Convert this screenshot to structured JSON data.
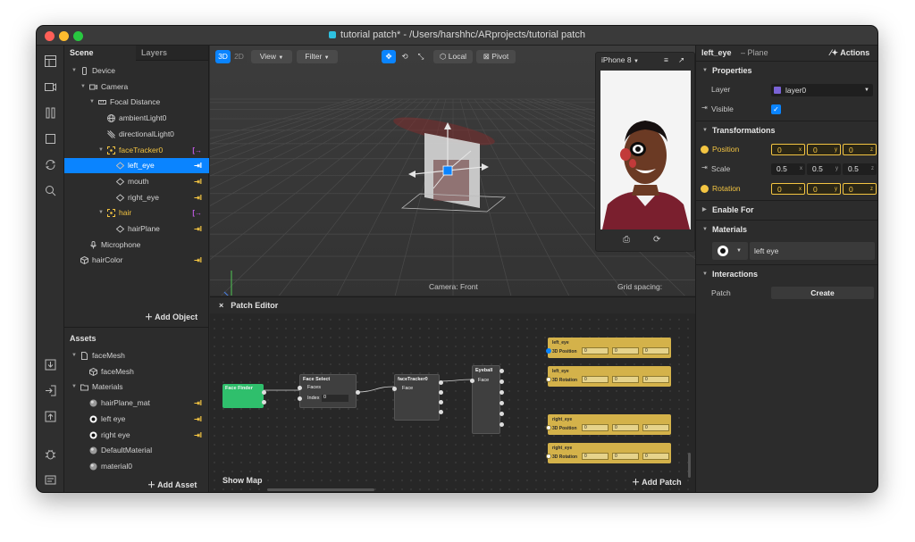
{
  "window": {
    "title": "tutorial patch* - /Users/harshhc/ARprojects/tutorial patch"
  },
  "scene": {
    "tabs": [
      "Scene",
      "Layers"
    ],
    "items": [
      {
        "label": "Device",
        "depth": 0,
        "caret": "▼",
        "icon": "phone-icon",
        "action": ""
      },
      {
        "label": "Camera",
        "depth": 1,
        "caret": "▼",
        "icon": "camera-icon",
        "action": ""
      },
      {
        "label": "Focal Distance",
        "depth": 2,
        "caret": "▼",
        "icon": "ruler-icon",
        "action": ""
      },
      {
        "label": "ambientLight0",
        "depth": 3,
        "caret": "",
        "icon": "globe-icon",
        "action": ""
      },
      {
        "label": "directionalLight0",
        "depth": 3,
        "caret": "",
        "icon": "light-icon",
        "action": ""
      },
      {
        "label": "faceTracker0",
        "depth": 3,
        "caret": "▼",
        "icon": "face-tracker-icon",
        "action": "[→",
        "yellow": true
      },
      {
        "label": "left_eye",
        "depth": 4,
        "caret": "",
        "icon": "plane-icon",
        "action": "⇥I",
        "selected": true
      },
      {
        "label": "mouth",
        "depth": 4,
        "caret": "",
        "icon": "plane-icon",
        "action": "⇥I"
      },
      {
        "label": "right_eye",
        "depth": 4,
        "caret": "",
        "icon": "plane-icon",
        "action": "⇥I"
      },
      {
        "label": "hair",
        "depth": 3,
        "caret": "▼",
        "icon": "face-tracker-icon",
        "action": "[→",
        "yellow": true
      },
      {
        "label": "hairPlane",
        "depth": 4,
        "caret": "",
        "icon": "plane-icon",
        "action": "⇥I"
      },
      {
        "label": "Microphone",
        "depth": 1,
        "caret": "",
        "icon": "microphone-icon",
        "action": ""
      },
      {
        "label": "hairColor",
        "depth": 0,
        "caret": "",
        "icon": "cube-icon",
        "action": "⇥I"
      }
    ],
    "add_object": "Add Object"
  },
  "assets": {
    "title": "Assets",
    "items": [
      {
        "label": "faceMesh",
        "depth": 0,
        "caret": "▼",
        "icon": "file-icon",
        "action": ""
      },
      {
        "label": "faceMesh",
        "depth": 1,
        "caret": "",
        "icon": "cube-icon",
        "action": ""
      },
      {
        "label": "Materials",
        "depth": 0,
        "caret": "▼",
        "icon": "folder-icon",
        "action": ""
      },
      {
        "label": "hairPlane_mat",
        "depth": 1,
        "caret": "",
        "icon": "sphere-icon",
        "action": "⇥I"
      },
      {
        "label": "left eye",
        "depth": 1,
        "caret": "",
        "icon": "eye-material-icon",
        "action": "⇥I"
      },
      {
        "label": "right eye",
        "depth": 1,
        "caret": "",
        "icon": "eye-material-icon",
        "action": "⇥I"
      },
      {
        "label": "DefaultMaterial",
        "depth": 1,
        "caret": "",
        "icon": "sphere-icon",
        "action": ""
      },
      {
        "label": "material0",
        "depth": 1,
        "caret": "",
        "icon": "sphere-icon",
        "action": ""
      }
    ],
    "add_asset": "Add Asset"
  },
  "viewport": {
    "mode_3d": "3D",
    "mode_2d": "2D",
    "view": "View",
    "filter": "Filter",
    "local": "Local",
    "pivot": "Pivot",
    "camera_label": "Camera: Front",
    "grid_label": "Grid spacing:",
    "device": "iPhone 8"
  },
  "patch_editor": {
    "title": "Patch Editor",
    "show_map": "Show Map",
    "add_patch": "Add Patch",
    "nodes": {
      "face_finder": "Face Finder",
      "face_select": "Face Select",
      "faces": "Faces",
      "index": "Index",
      "index_value": "0",
      "face_tracker": "faceTracker0",
      "face": "Face",
      "eyeball": "Eyeball",
      "eyeball_face": "Face"
    },
    "outputs": [
      {
        "title": "left_eye",
        "label": "3D Position",
        "values": [
          "0",
          "0",
          "0"
        ],
        "blue": true
      },
      {
        "title": "left_eye",
        "label": "3D Rotation",
        "values": [
          "0",
          "0",
          "0"
        ],
        "blue": false
      },
      {
        "title": "right_eye",
        "label": "3D Position",
        "values": [
          "0",
          "0",
          "0"
        ],
        "blue": false
      },
      {
        "title": "right_eye",
        "label": "3D Rotation",
        "values": [
          "0",
          "0",
          "0"
        ],
        "blue": false
      }
    ]
  },
  "properties": {
    "object_name": "left_eye",
    "object_type": "– Plane",
    "actions": "Actions",
    "sections": {
      "properties": "Properties",
      "transformations": "Transformations",
      "enable_for": "Enable For",
      "materials": "Materials",
      "interactions": "Interactions"
    },
    "layer_label": "Layer",
    "layer_value": "layer0",
    "visible_label": "Visible",
    "position_label": "Position",
    "position": [
      "0",
      "0",
      "0"
    ],
    "scale_label": "Scale",
    "scale": [
      "0.5",
      "0.5",
      "0.5"
    ],
    "rotation_label": "Rotation",
    "rotation": [
      "0",
      "0",
      "0"
    ],
    "axes": [
      "x",
      "y",
      "z"
    ],
    "material_value": "left eye",
    "patch_label": "Patch",
    "create_label": "Create"
  },
  "colors": {
    "accent": "#0a84ff",
    "yellow": "#f4c542",
    "purple": "#c35be6",
    "patch_green": "#2fbf6c",
    "patch_yellow": "#d4b24a"
  }
}
